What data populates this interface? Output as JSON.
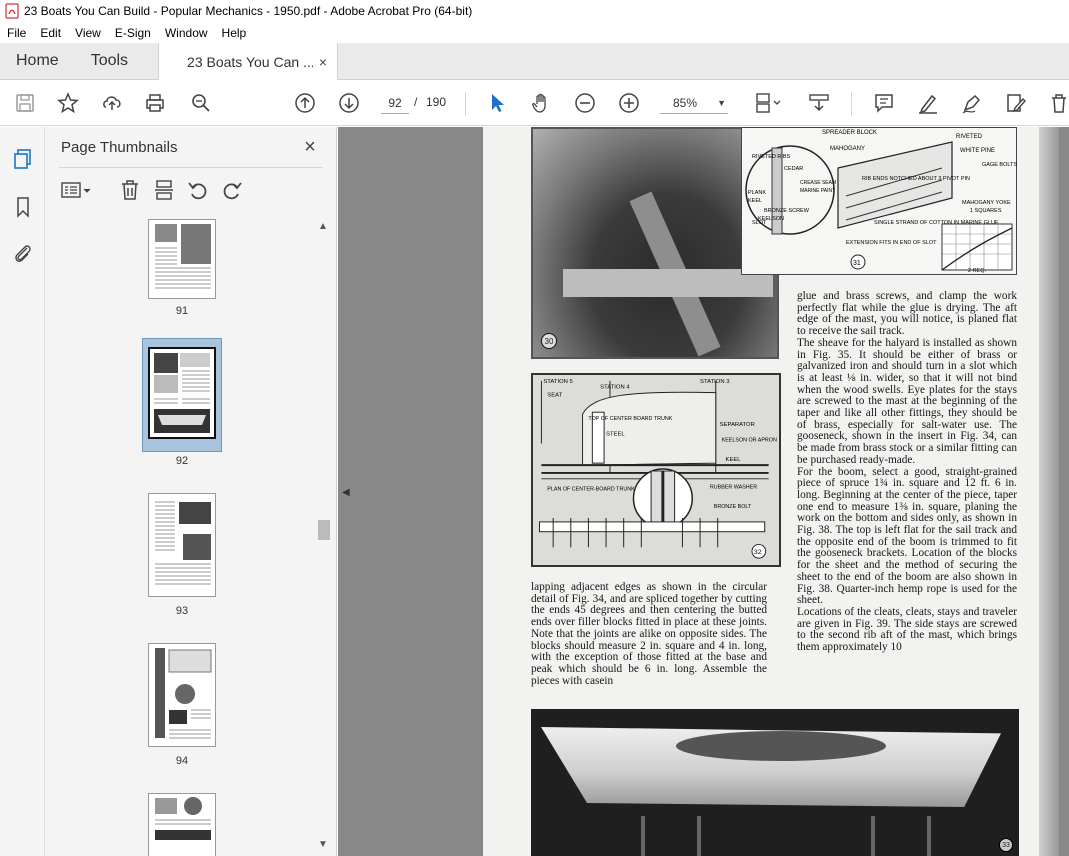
{
  "window": {
    "title": "23 Boats You Can Build - Popular Mechanics - 1950.pdf - Adobe Acrobat Pro (64-bit)"
  },
  "menu": [
    "File",
    "Edit",
    "View",
    "E-Sign",
    "Window",
    "Help"
  ],
  "tabs": {
    "home": "Home",
    "tools": "Tools",
    "document": "23 Boats You Can ...",
    "close": "×"
  },
  "toolbar": {
    "current_page": "92",
    "page_separator": "/",
    "total_pages": "190",
    "zoom": "85%"
  },
  "panel": {
    "title": "Page Thumbnails",
    "close": "×",
    "thumbnails": [
      {
        "label": "91",
        "selected": false
      },
      {
        "label": "92",
        "selected": true
      },
      {
        "label": "93",
        "selected": false
      },
      {
        "label": "94",
        "selected": false
      },
      {
        "label": "",
        "selected": false
      }
    ]
  },
  "document": {
    "diagram_31_labels": [
      "SPREADER BLOCK",
      "MAHOGANY",
      "RIVETED",
      "WHITE PINE",
      "RIVETED RIBS",
      "CEDAR",
      "CREASE SEAM",
      "MARINE PAINT",
      "RIB ENDS NOTCHED ABOUT 3 PIVOT PIN",
      "GAGE BOLTS",
      "PLANK",
      "KEEL",
      "BRONZE SCREW",
      "SLOT",
      "MAHOGANY YOKE",
      "1 SQUARES",
      "KEELSON",
      "SINGLE STRAND OF COTTON IN MARINE GLUE",
      "EXTENSION FITS IN END OF SLOT",
      "2 REQ."
    ],
    "figure_numbers": [
      "31",
      "30",
      "32",
      "33"
    ],
    "diagram_32_labels": [
      "STATION 5",
      "STATION 4",
      "STATION 3",
      "SEAT",
      "TOP OF CENTER BOARD TRUNK",
      "STEEL",
      "SEPARATOR",
      "KEELSON OR APRON",
      "KEEL",
      "RUBBER WASHER",
      "BRONZE BOLT",
      "PLAN OF CENTER-BOARD TRUNK"
    ],
    "right_column_text": "glue and brass screws, and clamp the work perfectly flat while the glue is drying. The aft edge of the mast, you will notice, is planed flat to receive the sail track.\n  The sheave for the halyard is installed as shown in Fig. 35. It should be either of brass or galvanized iron and should turn in a slot which is at least ⅛ in. wider, so that it will not bind when the wood swells. Eye plates for the stays are screwed to the mast at the beginning of the taper and like all other fittings, they should be of brass, especially for salt-water use. The gooseneck, shown in the insert in Fig. 34, can be made from brass stock or a similar fitting can be purchased ready-made.\n  For the boom, select a good, straight-grained piece of spruce 1¾ in. square and 12 ft. 6 in. long. Beginning at the center of the piece, taper one end to measure 1⅜ in. square, planing the work on the bottom and sides only, as shown in Fig. 38. The top is left flat for the sail track and the opposite end of the boom is trimmed to fit the gooseneck brackets. Location of the blocks for the sheet and the method of securing the sheet to the end of the boom are also shown in Fig. 38. Quarter-inch hemp rope is used for the sheet.\n  Locations of the cleats, cleats, stays and traveler are given in Fig. 39. The side stays are screwed to the second rib aft of the mast, which brings them approximately 10",
    "left_column_text": "lapping adjacent edges as shown in the circular detail of Fig. 34, and are spliced together by cutting the ends 45 degrees and then centering the butted ends over filler blocks fitted in place at these joints. Note that the joints are alike on opposite sides. The blocks should measure 2 in. square and 4 in. long, with the exception of those fitted at the base and peak which should be 6 in. long. Assemble the pieces with casein"
  },
  "icons": {
    "accent": "#1a73c9",
    "pdf_red": "#d9302c"
  }
}
